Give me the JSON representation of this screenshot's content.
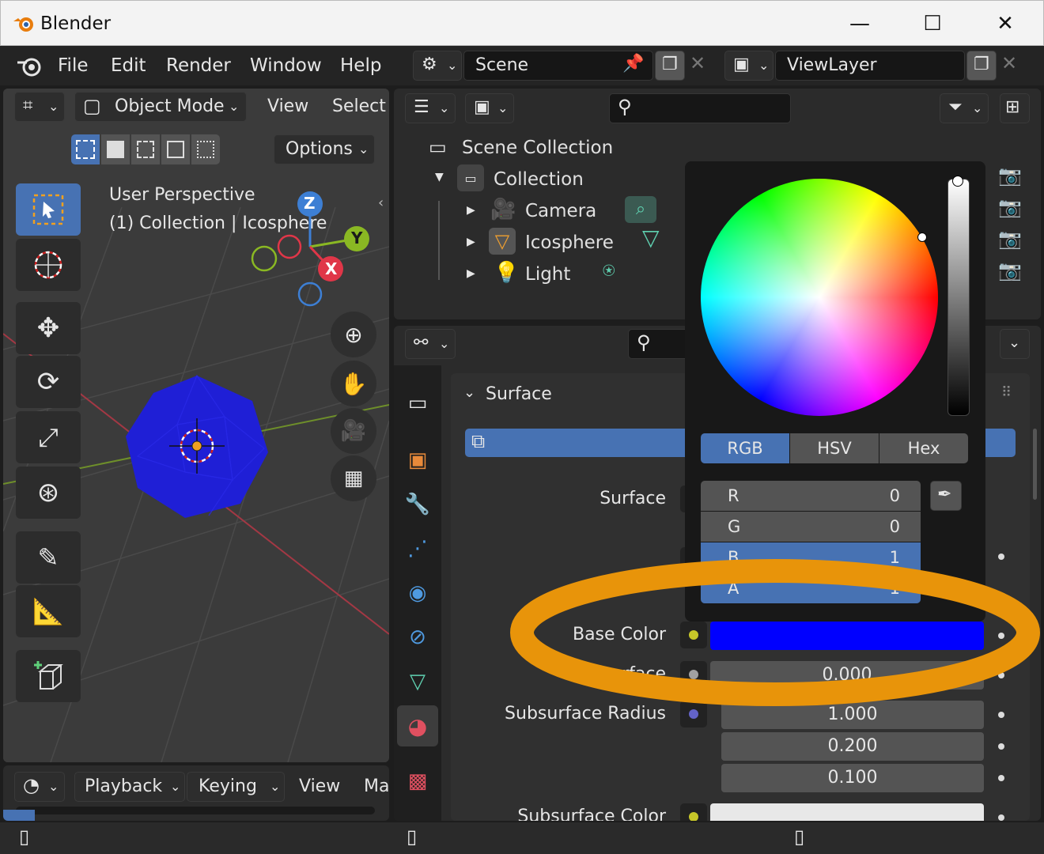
{
  "window": {
    "title": "Blender",
    "controls": {
      "minimize": "—",
      "maximize": "☐",
      "close": "✕"
    }
  },
  "menubar": {
    "items": [
      "File",
      "Edit",
      "Render",
      "Window",
      "Help"
    ],
    "scene_name": "Scene",
    "view_layer_name": "ViewLayer"
  },
  "viewport": {
    "mode": "Object Mode",
    "header_menus": [
      "View",
      "Select"
    ],
    "options_label": "Options",
    "overlay_line1": "User Perspective",
    "overlay_line2": "(1) Collection | Icosphere",
    "gizmo": {
      "z": "Z",
      "y": "Y",
      "x": "X"
    },
    "object_color": "#1f1fd6"
  },
  "timeline": {
    "menus": [
      "Playback",
      "Keying",
      "View",
      "Ma"
    ]
  },
  "outliner": {
    "root": "Scene Collection",
    "collection": "Collection",
    "items": [
      {
        "name": "Camera",
        "icon": "camera-icon"
      },
      {
        "name": "Icosphere",
        "icon": "mesh-icon"
      },
      {
        "name": "Light",
        "icon": "light-icon"
      }
    ]
  },
  "properties": {
    "panel_title": "Surface",
    "surface_label": "Surface",
    "base_color_label": "Base Color",
    "base_color_value": "#0000ff",
    "subsurface_label": "Subsurface",
    "subsurface_value": "0.000",
    "subsurface_radius_label": "Subsurface Radius",
    "subsurface_radius_values": [
      "1.000",
      "0.200",
      "0.100"
    ],
    "subsurface_color_label": "Subsurface Color"
  },
  "color_picker": {
    "modes": [
      "RGB",
      "HSV",
      "Hex"
    ],
    "active_mode": "RGB",
    "channels": [
      {
        "label": "R",
        "value": "0"
      },
      {
        "label": "G",
        "value": "0"
      },
      {
        "label": "B",
        "value": "1"
      },
      {
        "label": "A",
        "value": "1"
      }
    ],
    "highlighted_channel": "B"
  },
  "annotation": {
    "color": "#e8940a"
  }
}
